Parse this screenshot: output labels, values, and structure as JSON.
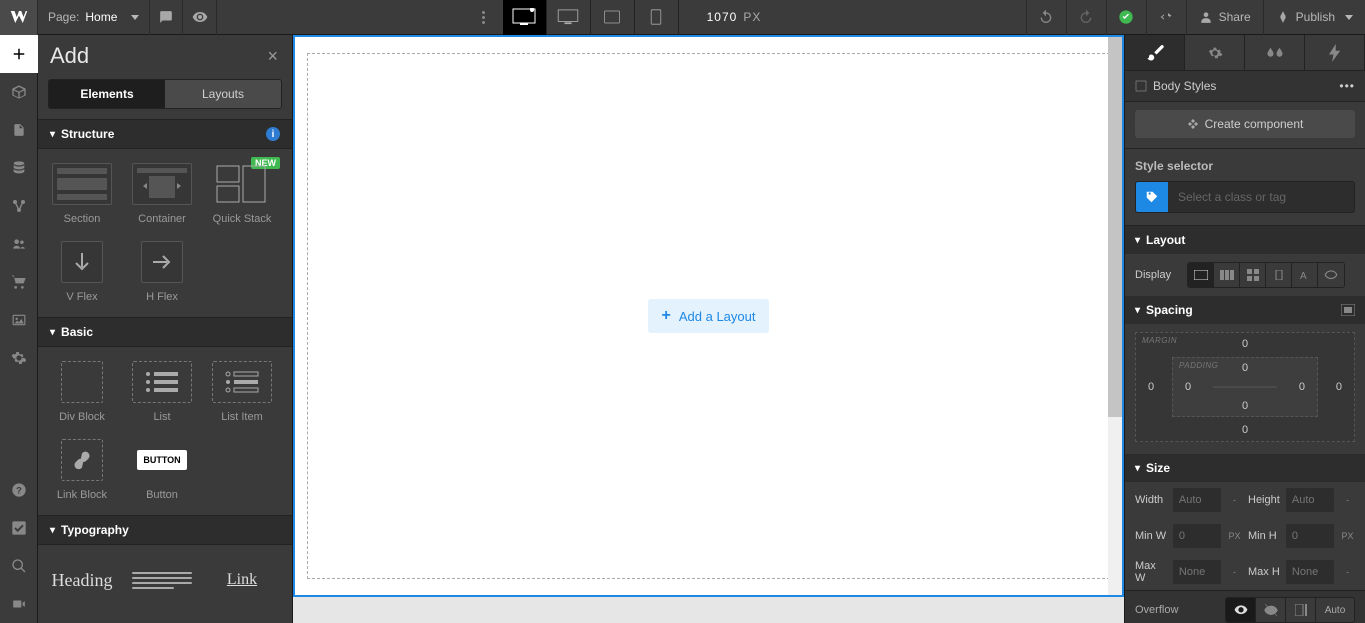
{
  "topbar": {
    "page_label": "Page:",
    "page_name": "Home",
    "px_value": "1070",
    "px_label": "PX",
    "share": "Share",
    "publish": "Publish"
  },
  "addPanel": {
    "title": "Add",
    "tabs": {
      "elements": "Elements",
      "layouts": "Layouts"
    },
    "sections": {
      "structure": "Structure",
      "basic": "Basic",
      "typography": "Typography"
    },
    "structure": {
      "section": "Section",
      "container": "Container",
      "quick_stack": "Quick Stack",
      "vflex": "V Flex",
      "hflex": "H Flex",
      "new_badge": "NEW"
    },
    "basic": {
      "div_block": "Div Block",
      "list": "List",
      "list_item": "List Item",
      "link_block": "Link Block",
      "button": "Button",
      "button_chip": "BUTTON"
    },
    "typography": {
      "heading": "Heading",
      "link": "Link"
    }
  },
  "canvas": {
    "add_layout": "Add a Layout"
  },
  "rightPanel": {
    "body_styles": "Body Styles",
    "create_component": "Create component",
    "style_selector": "Style selector",
    "class_placeholder": "Select a class or tag",
    "layout": "Layout",
    "display_label": "Display",
    "spacing": "Spacing",
    "margin_label": "MARGIN",
    "padding_label": "PADDING",
    "margin": {
      "top": "0",
      "right": "0",
      "bottom": "0",
      "left": "0"
    },
    "padding": {
      "top": "0",
      "right": "0",
      "bottom": "0",
      "left": "0"
    },
    "size": "Size",
    "size_rows": {
      "width": "Width",
      "width_val": "Auto",
      "width_unit": "-",
      "height": "Height",
      "height_val": "Auto",
      "height_unit": "-",
      "minw": "Min W",
      "minw_val": "0",
      "minw_unit": "PX",
      "minh": "Min H",
      "minh_val": "0",
      "minh_unit": "PX",
      "maxw": "Max W",
      "maxw_val": "None",
      "maxw_unit": "-",
      "maxh": "Max H",
      "maxh_val": "None",
      "maxh_unit": "-"
    },
    "overflow_label": "Overflow",
    "overflow_auto": "Auto"
  }
}
